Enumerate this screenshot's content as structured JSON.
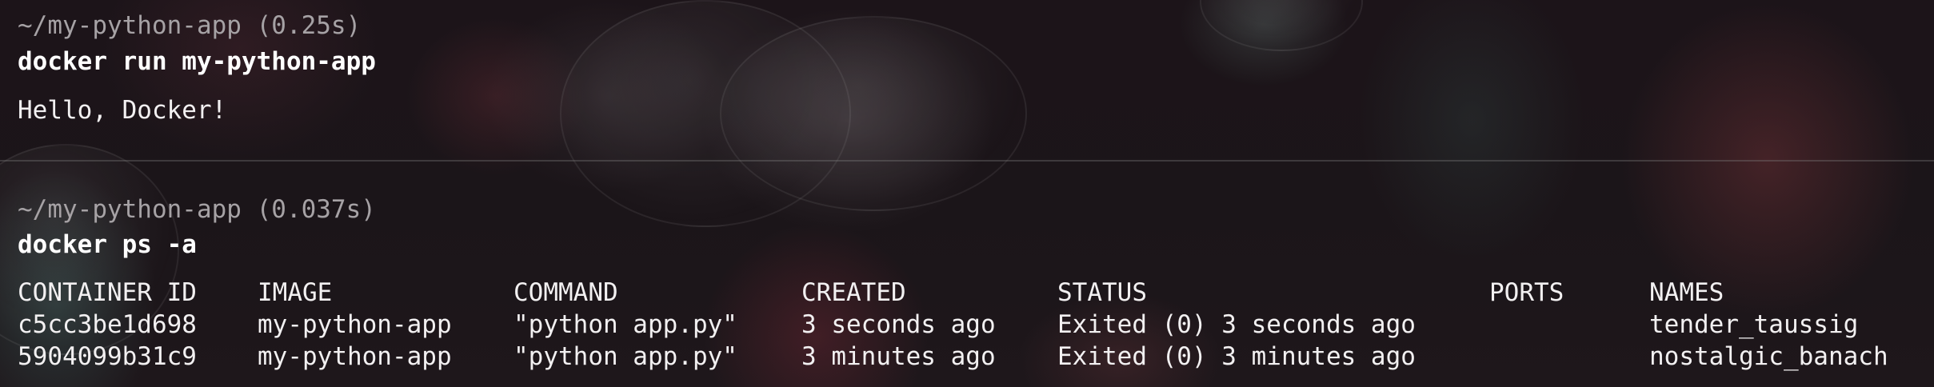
{
  "blocks": [
    {
      "prompt": "~/my-python-app (0.25s)",
      "command": "docker run my-python-app",
      "output": "Hello, Docker!"
    },
    {
      "prompt": "~/my-python-app (0.037s)",
      "command": "docker ps -a"
    }
  ],
  "table": {
    "headers": [
      "CONTAINER ID",
      "IMAGE",
      "COMMAND",
      "CREATED",
      "STATUS",
      "PORTS",
      "NAMES"
    ],
    "rows": [
      [
        "c5cc3be1d698",
        "my-python-app",
        "\"python app.py\"",
        "3 seconds ago",
        "Exited (0) 3 seconds ago",
        "",
        "tender_taussig"
      ],
      [
        "5904099b31c9",
        "my-python-app",
        "\"python app.py\"",
        "3 minutes ago",
        "Exited (0) 3 minutes ago",
        "",
        "nostalgic_banach"
      ]
    ]
  },
  "colors": {
    "prompt": "#a6a2a5",
    "command": "#ffffff",
    "output": "#f2f0f1",
    "background": "#191317"
  }
}
